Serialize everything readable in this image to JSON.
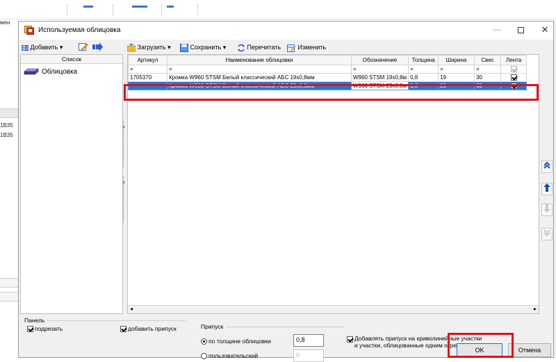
{
  "background": {
    "menu_fragment": "мен",
    "row_labels": [
      "1В35",
      "1В35"
    ]
  },
  "dialog": {
    "title": "Используемая облицовка",
    "min_glyph": "—",
    "close_glyph": "✕"
  },
  "left_toolbar": {
    "add_label": "Добавить",
    "dropdown_glyph": "▾"
  },
  "list": {
    "header": "Список",
    "items": [
      {
        "label": "Облицовка"
      }
    ]
  },
  "right_toolbar": {
    "load_label": "Загрузить",
    "save_label": "Сохранить",
    "reread_label": "Перечитать",
    "edit_label": "Изменить"
  },
  "grid": {
    "columns": [
      "Артикул",
      "Наименование облицовки",
      "Обозначение",
      "Толщина",
      "Ширина",
      "Свес",
      "Лента"
    ],
    "filter_symbol": "=",
    "rows": [
      {
        "article": "1705370",
        "name": "Кромка W960 STSM Белый классический  АБС 19х0,8мм",
        "designation": "W960 STSM 19х0,8м",
        "thickness": "0,8",
        "width": "19",
        "overhang": "30",
        "tape": true
      },
      {
        "article": "",
        "name": "Кромка W960 STSM Белый классический  АБС 23х0,8мм",
        "designation": "W960 STSM 23х0,8м",
        "thickness": "0,8",
        "width": "23",
        "overhang": "30",
        "tape": true
      }
    ],
    "selected_row": 1
  },
  "nav_buttons": [
    "move-top",
    "move-up",
    "move-down",
    "move-bottom"
  ],
  "panel": {
    "title": "Панель",
    "trim_label": "подрезать",
    "trim_checked": true,
    "add_allowance_label": "добавить припуск",
    "add_allowance_checked": true
  },
  "allowance": {
    "title": "Припуск",
    "by_thickness_label": "по толщине облицовки",
    "by_thickness_value": "0,8",
    "custom_label": "пользовательский",
    "custom_value": "0",
    "selected": "by_thickness"
  },
  "curved": {
    "label_line1": "Добавлять припуск на криволинейные участки",
    "label_line2": "и участки, облицованные одним отрезом",
    "checked": true
  },
  "buttons": {
    "ok_label": "OK",
    "cancel_label": "Отмена"
  },
  "colors": {
    "selection": "#1c7bd8",
    "highlight_box": "#e0101a",
    "dialog_bg": "#f0f0f0"
  }
}
